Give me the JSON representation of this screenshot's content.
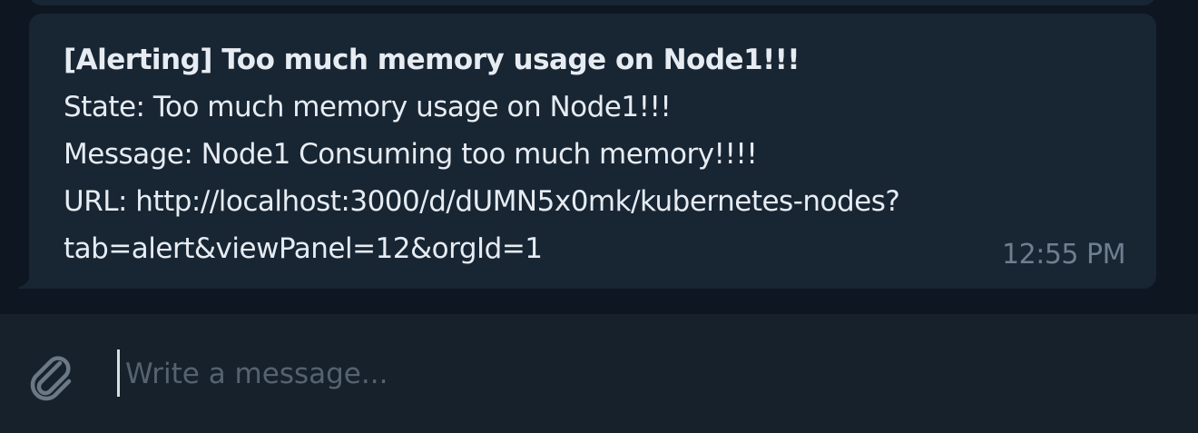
{
  "message": {
    "title": "[Alerting] Too much memory usage on Node1!!!",
    "state_line": "State: Too much memory usage on Node1!!!",
    "message_line": "Message: Node1 Consuming too much memory!!!!",
    "url_line_1": "URL: http://localhost:3000/d/dUMN5x0mk/kubernetes-nodes?",
    "url_line_2": "tab=alert&viewPanel=12&orgId=1",
    "time": "12:55 PM"
  },
  "composer": {
    "placeholder": "Write a message...",
    "attach_icon": "paperclip-icon"
  },
  "colors": {
    "background": "#0e1621",
    "bubble": "#182533",
    "composer": "#17212b",
    "text": "#e6ecf2",
    "muted": "#6d7f8f"
  }
}
